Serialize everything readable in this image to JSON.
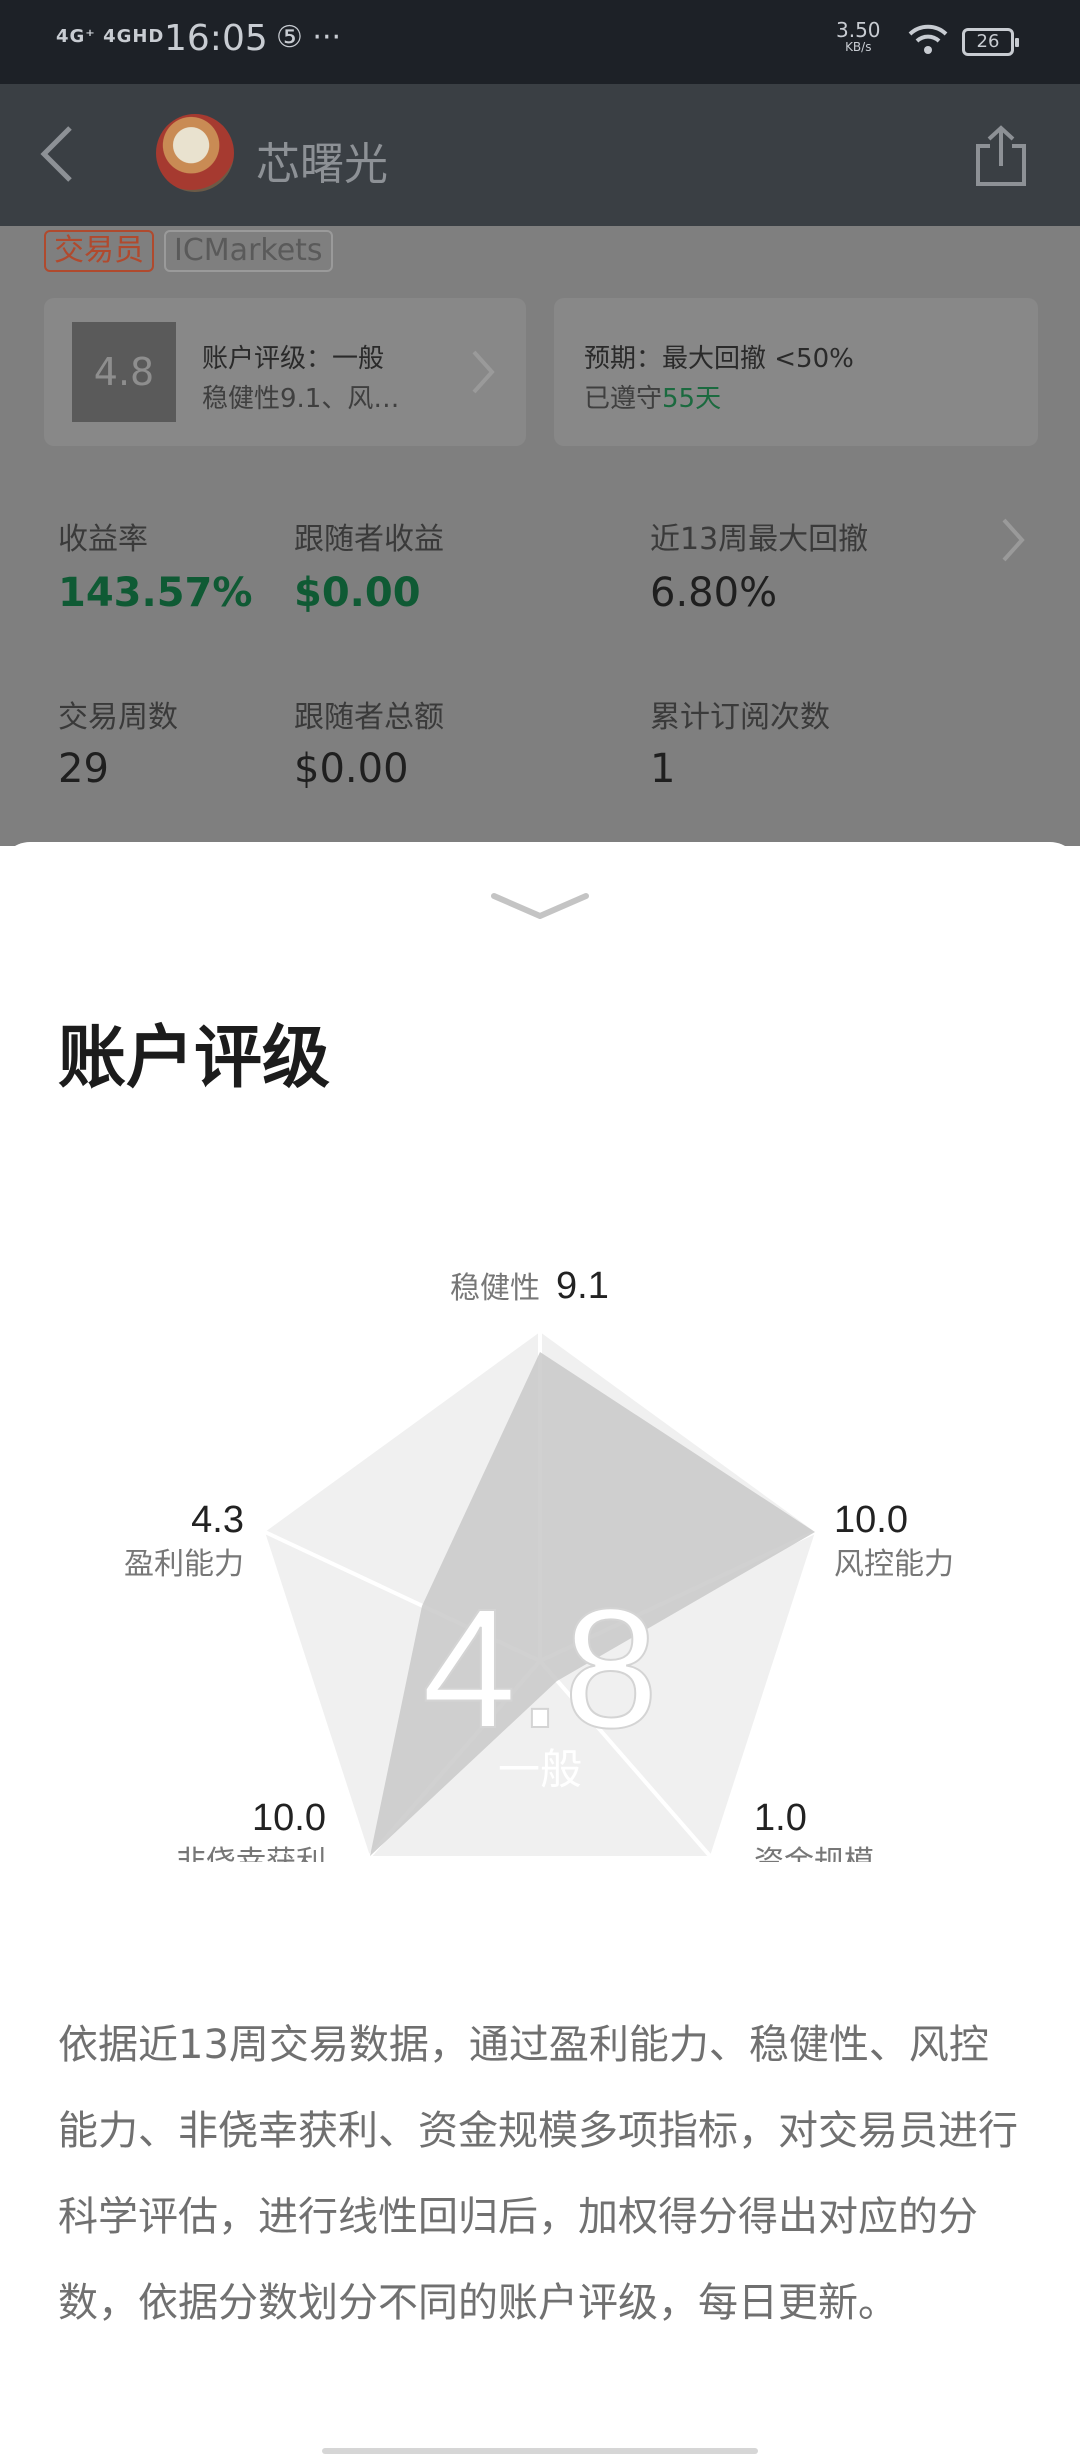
{
  "status_bar": {
    "signal": "4G⁺ 4GHD",
    "time": "16:05",
    "extras": "⑤ ···",
    "speed_value": "3.50",
    "speed_unit": "KB/s",
    "battery": "26"
  },
  "header": {
    "trader_name": "芯曙光"
  },
  "tags": {
    "trader": "交易员",
    "broker": "ICMarkets"
  },
  "rating_card": {
    "score": "4.8",
    "line1": "账户评级：一般",
    "line2": "稳健性9.1、风…"
  },
  "expect_card": {
    "line1": "预期：最大回撤 <50%",
    "line2_prefix": "已遵守",
    "line2_days": "55天"
  },
  "stats": {
    "return_label": "收益率",
    "return_value": "143.57%",
    "follower_profit_label": "跟随者收益",
    "follower_profit_value": "$0.00",
    "drawdown_label": "近13周最大回撤",
    "drawdown_value": "6.80%",
    "weeks_label": "交易周数",
    "weeks_value": "29",
    "follower_total_label": "跟随者总额",
    "follower_total_value": "$0.00",
    "subs_label": "累计订阅次数",
    "subs_value": "1"
  },
  "sheet": {
    "title": "账户评级",
    "overall_score": "4.8",
    "overall_grade": "一般",
    "axes": [
      {
        "label": "稳健性",
        "value": "9.1"
      },
      {
        "label": "风控能力",
        "value": "10.0"
      },
      {
        "label": "资金规模",
        "value": "1.0"
      },
      {
        "label": "非侥幸获利",
        "value": "10.0"
      },
      {
        "label": "盈利能力",
        "value": "4.3"
      }
    ],
    "description": "依据近13周交易数据，通过盈利能力、稳健性、风控能力、非侥幸获利、资金规模多项指标，对交易员进行科学评估，进行线性回归后，加权得分得出对应的分数，依据分数划分不同的账户评级，每日更新。"
  },
  "colors": {
    "profit_green": "#14a35a",
    "radar_outer": "#f0f0f0",
    "radar_inner": "#c9c9c9"
  }
}
